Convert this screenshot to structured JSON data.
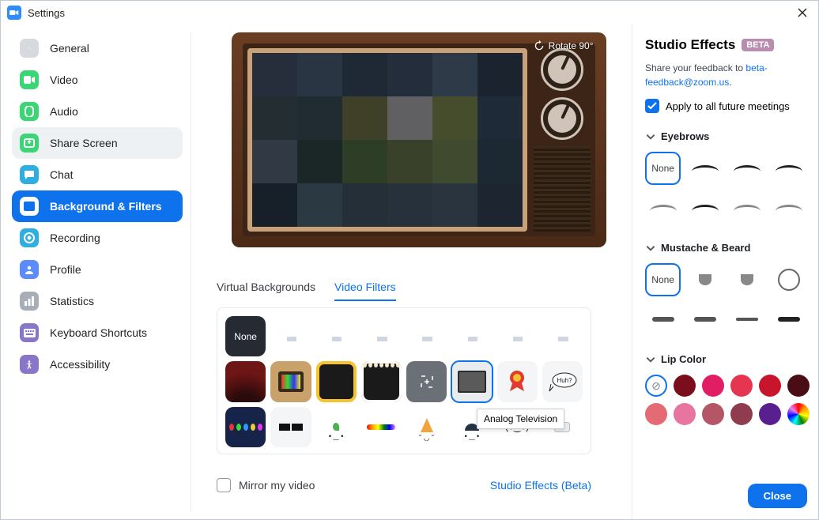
{
  "window": {
    "title": "Settings"
  },
  "sidebar": {
    "items": [
      {
        "label": "General",
        "icon": "gear-icon",
        "color": "#d6d9de"
      },
      {
        "label": "Video",
        "icon": "video-icon",
        "color": "#3ad675"
      },
      {
        "label": "Audio",
        "icon": "audio-icon",
        "color": "#3ad675"
      },
      {
        "label": "Share Screen",
        "icon": "share-icon",
        "color": "#3ad675",
        "state": "hover"
      },
      {
        "label": "Chat",
        "icon": "chat-icon",
        "color": "#2faee0"
      },
      {
        "label": "Background & Filters",
        "icon": "bg-icon",
        "color": "#fff",
        "state": "active"
      },
      {
        "label": "Recording",
        "icon": "record-icon",
        "color": "#2faee0"
      },
      {
        "label": "Profile",
        "icon": "profile-icon",
        "color": "#5a8bff"
      },
      {
        "label": "Statistics",
        "icon": "stats-icon",
        "color": "#a7aeb8"
      },
      {
        "label": "Keyboard Shortcuts",
        "icon": "keyboard-icon",
        "color": "#8a76c9"
      },
      {
        "label": "Accessibility",
        "icon": "accessibility-icon",
        "color": "#8a76c9"
      }
    ]
  },
  "preview": {
    "rotate_label": "Rotate 90°"
  },
  "tabs": {
    "virtual_backgrounds": "Virtual Backgrounds",
    "video_filters": "Video Filters",
    "active": "video_filters"
  },
  "filters": {
    "none_label": "None",
    "selected_index": 13,
    "tooltip": "Analog Television",
    "room_tints": [
      "#d6d6d6",
      "#9b9b9b",
      "#d6b88f",
      "#e5e2d9",
      "#d6b88f",
      "#d6b88f",
      "#f7c7cc"
    ],
    "deco": [
      "curtain",
      "retro-tv",
      "emoji-frame",
      "dots-border",
      "target",
      "analog-tv",
      "ribbon",
      "huh",
      "lights",
      "pixel-glasses",
      "leaf-face",
      "rainbow-bar",
      "party-hat",
      "cap-face",
      "kawaii",
      "mask"
    ]
  },
  "footer": {
    "mirror_label": "Mirror my video",
    "mirror_checked": false,
    "studio_link": "Studio Effects (Beta)"
  },
  "studio": {
    "title": "Studio Effects",
    "badge": "BETA",
    "feedback_prefix": "Share your feedback to",
    "feedback_email": "beta-feedback@zoom.us",
    "apply_label": "Apply to all future meetings",
    "apply_checked": true,
    "sections": {
      "eyebrows": "Eyebrows",
      "mustache": "Mustache & Beard",
      "lip": "Lip Color"
    },
    "none_label": "None",
    "lip_colors": [
      "none",
      "#7a0e1a",
      "#e11e63",
      "#e63550",
      "#c9142d",
      "#4b0d15",
      "#e46a76",
      "#e874a0",
      "#b55666",
      "#8f3c4f",
      "#5a1f8e",
      "rainbow"
    ],
    "close_label": "Close"
  }
}
